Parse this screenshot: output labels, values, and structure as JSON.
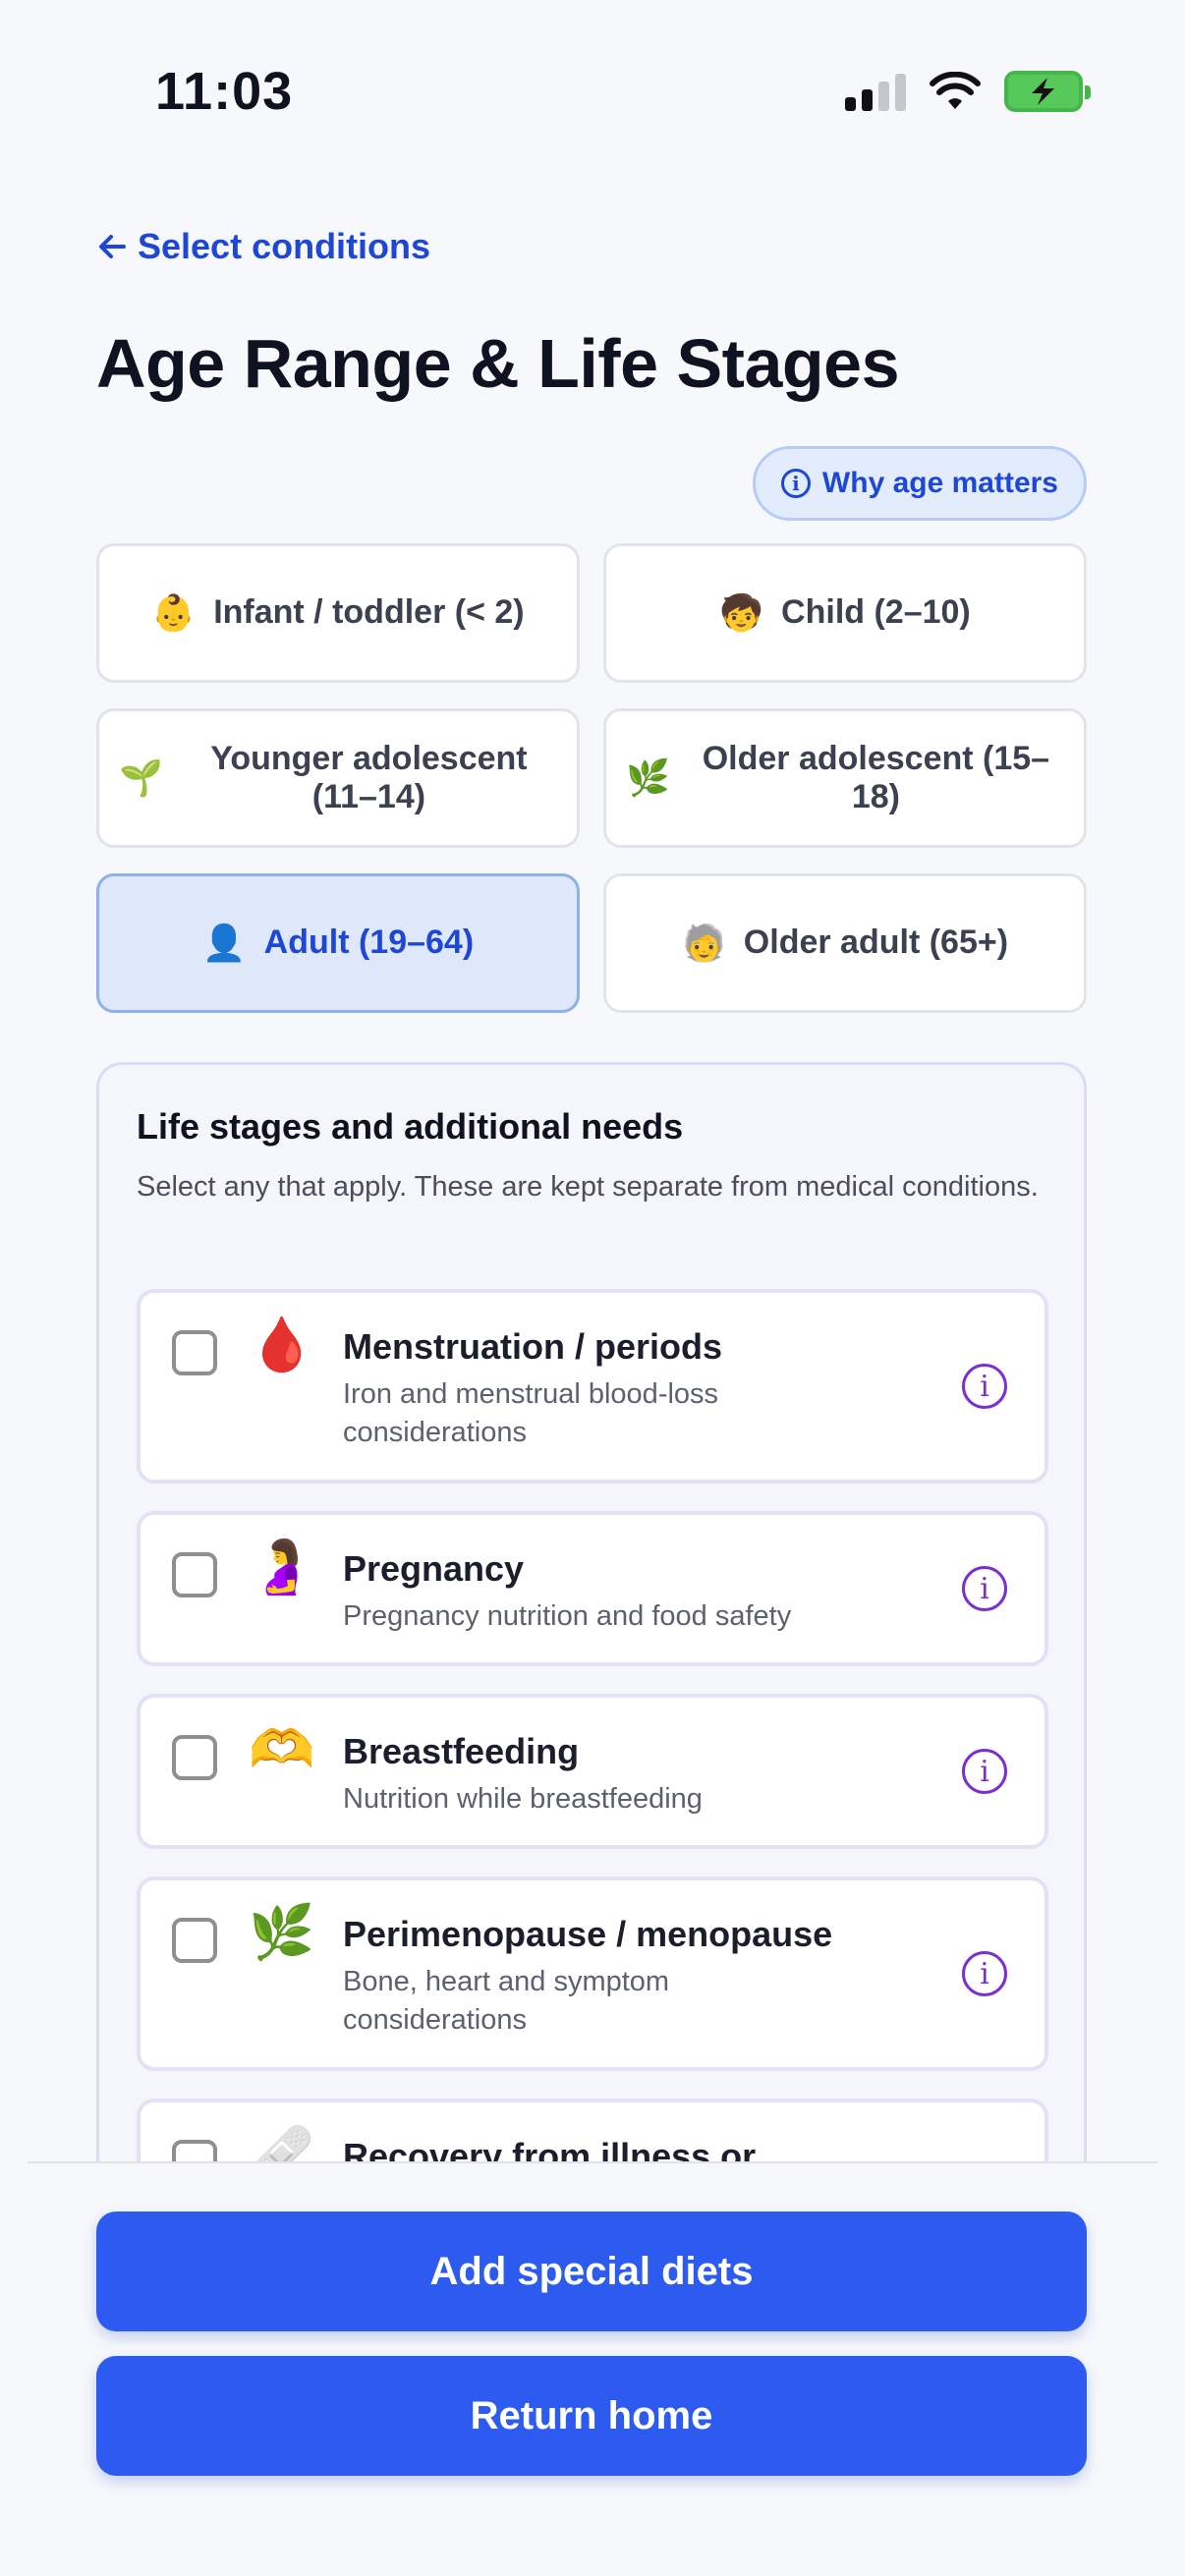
{
  "status": {
    "time": "11:03"
  },
  "header": {
    "back_label": "Select conditions",
    "title": "Age Range & Life Stages",
    "why_label": "Why age matters"
  },
  "age_options": [
    {
      "emoji": "👶",
      "label": "Infant / toddler (< 2)",
      "selected": false
    },
    {
      "emoji": "🧒",
      "label": "Child (2–10)",
      "selected": false
    },
    {
      "emoji": "🌱",
      "label": "Younger adolescent (11–14)",
      "selected": false
    },
    {
      "emoji": "🌿",
      "label": "Older adolescent (15–18)",
      "selected": false
    },
    {
      "emoji": "👤",
      "label": "Adult (19–64)",
      "selected": true
    },
    {
      "emoji": "🧓",
      "label": "Older adult (65+)",
      "selected": false
    }
  ],
  "life_stages": {
    "title": "Life stages and additional needs",
    "subtitle": "Select any that apply. These are kept separate from medical conditions.",
    "items": [
      {
        "emoji": "🩸",
        "title": "Menstruation / periods",
        "desc": "Iron and menstrual blood-loss considerations",
        "checked": false
      },
      {
        "emoji": "🤰",
        "title": "Pregnancy",
        "desc": "Pregnancy nutrition and food safety",
        "checked": false
      },
      {
        "emoji": "🫶",
        "title": "Breastfeeding",
        "desc": "Nutrition while breastfeeding",
        "checked": false
      },
      {
        "emoji": "🌿",
        "title": "Perimenopause / menopause",
        "desc": "Bone, heart and symptom considerations",
        "checked": false
      },
      {
        "emoji": "🩹",
        "title": "Recovery from illness or",
        "desc": "",
        "checked": false
      }
    ]
  },
  "actions": {
    "primary": "Add special diets",
    "secondary": "Return home"
  }
}
